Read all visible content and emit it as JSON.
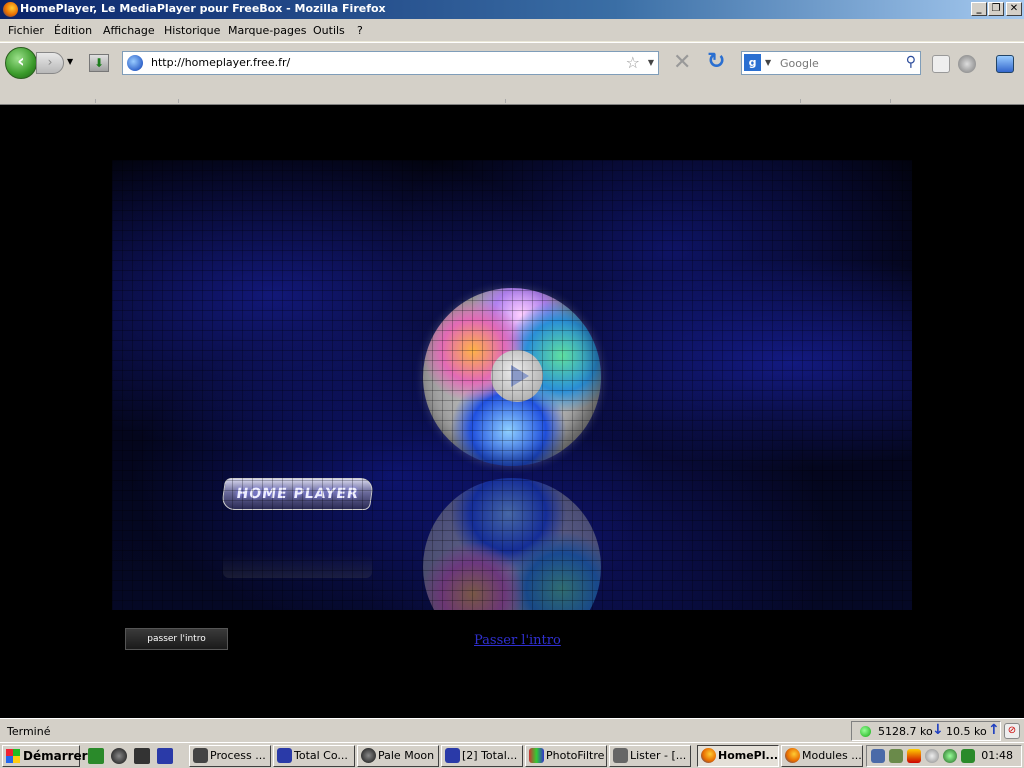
{
  "window": {
    "title": "HomePlayer, Le MediaPlayer pour FreeBox - Mozilla Firefox",
    "min_label": "_",
    "restore_label": "❐",
    "close_label": "✕"
  },
  "menu": {
    "items": [
      {
        "label": "Fichier"
      },
      {
        "label": "Édition"
      },
      {
        "label": "Affichage"
      },
      {
        "label": "Historique"
      },
      {
        "label": "Marque-pages"
      },
      {
        "label": "Outils"
      },
      {
        "label": "?"
      }
    ]
  },
  "nav": {
    "back_icon": "‹",
    "forward_icon": "›",
    "url": "http://homeplayer.free.fr/",
    "search_engine_icon": "g",
    "search_placeholder": "Google"
  },
  "page": {
    "logo_text": "HOME PLAYER",
    "skip_button_label": "passer l'intro",
    "skip_link_label": "Passer l'intro"
  },
  "status": {
    "text": "Terminé",
    "download_rate": "5128.7 ko",
    "upload_rate": "10.5 ko"
  },
  "taskbar": {
    "start_label": "Démarrer",
    "tasks": [
      {
        "label": "Process ...",
        "color": "#444444"
      },
      {
        "label": "Total Co...",
        "color": "#2a3aa8"
      },
      {
        "label": "Pale Moon",
        "color": "#333333"
      },
      {
        "label": "[2] Total...",
        "color": "#2a3aa8"
      },
      {
        "label": "PhotoFiltre",
        "color": "#c83030"
      },
      {
        "label": "Lister - [...",
        "color": "#555555"
      },
      {
        "label": "HomePl...",
        "color": "#e76b00"
      },
      {
        "label": "Modules ...",
        "color": "#e76b00"
      }
    ],
    "clock": "01:48"
  }
}
